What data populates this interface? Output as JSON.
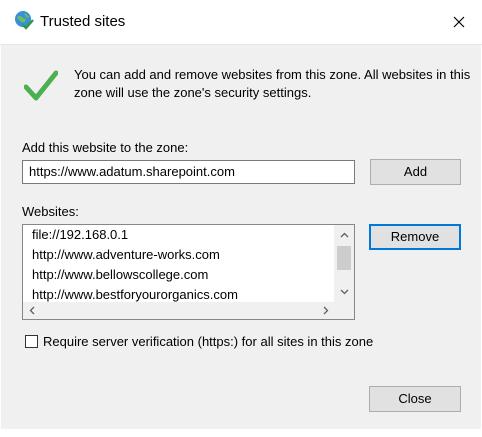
{
  "dialog": {
    "title": "Trusted sites",
    "icon": "globe-checkmark-icon",
    "close_icon": "close-icon"
  },
  "info": {
    "icon": "green-checkmark-icon",
    "text": "You can add and remove websites from this zone. All websites in this zone will use the zone's security settings."
  },
  "add_site": {
    "label": "Add this website to the zone:",
    "value": "https://www.adatum.sharepoint.com",
    "button_label": "Add"
  },
  "websites": {
    "label": "Websites:",
    "items": [
      "file://192.168.0.1",
      "http://www.adventure-works.com",
      "http://www.bellowscollege.com",
      "http://www.bestforyourorganics.com"
    ],
    "remove_label": "Remove"
  },
  "verification": {
    "label": "Require server verification (https:) for all sites in this zone",
    "checked": false
  },
  "footer": {
    "close_label": "Close"
  },
  "colors": {
    "accent": "#0078d7",
    "check_green": "#4caf50",
    "dialog_bg": "#f0f0f0"
  }
}
